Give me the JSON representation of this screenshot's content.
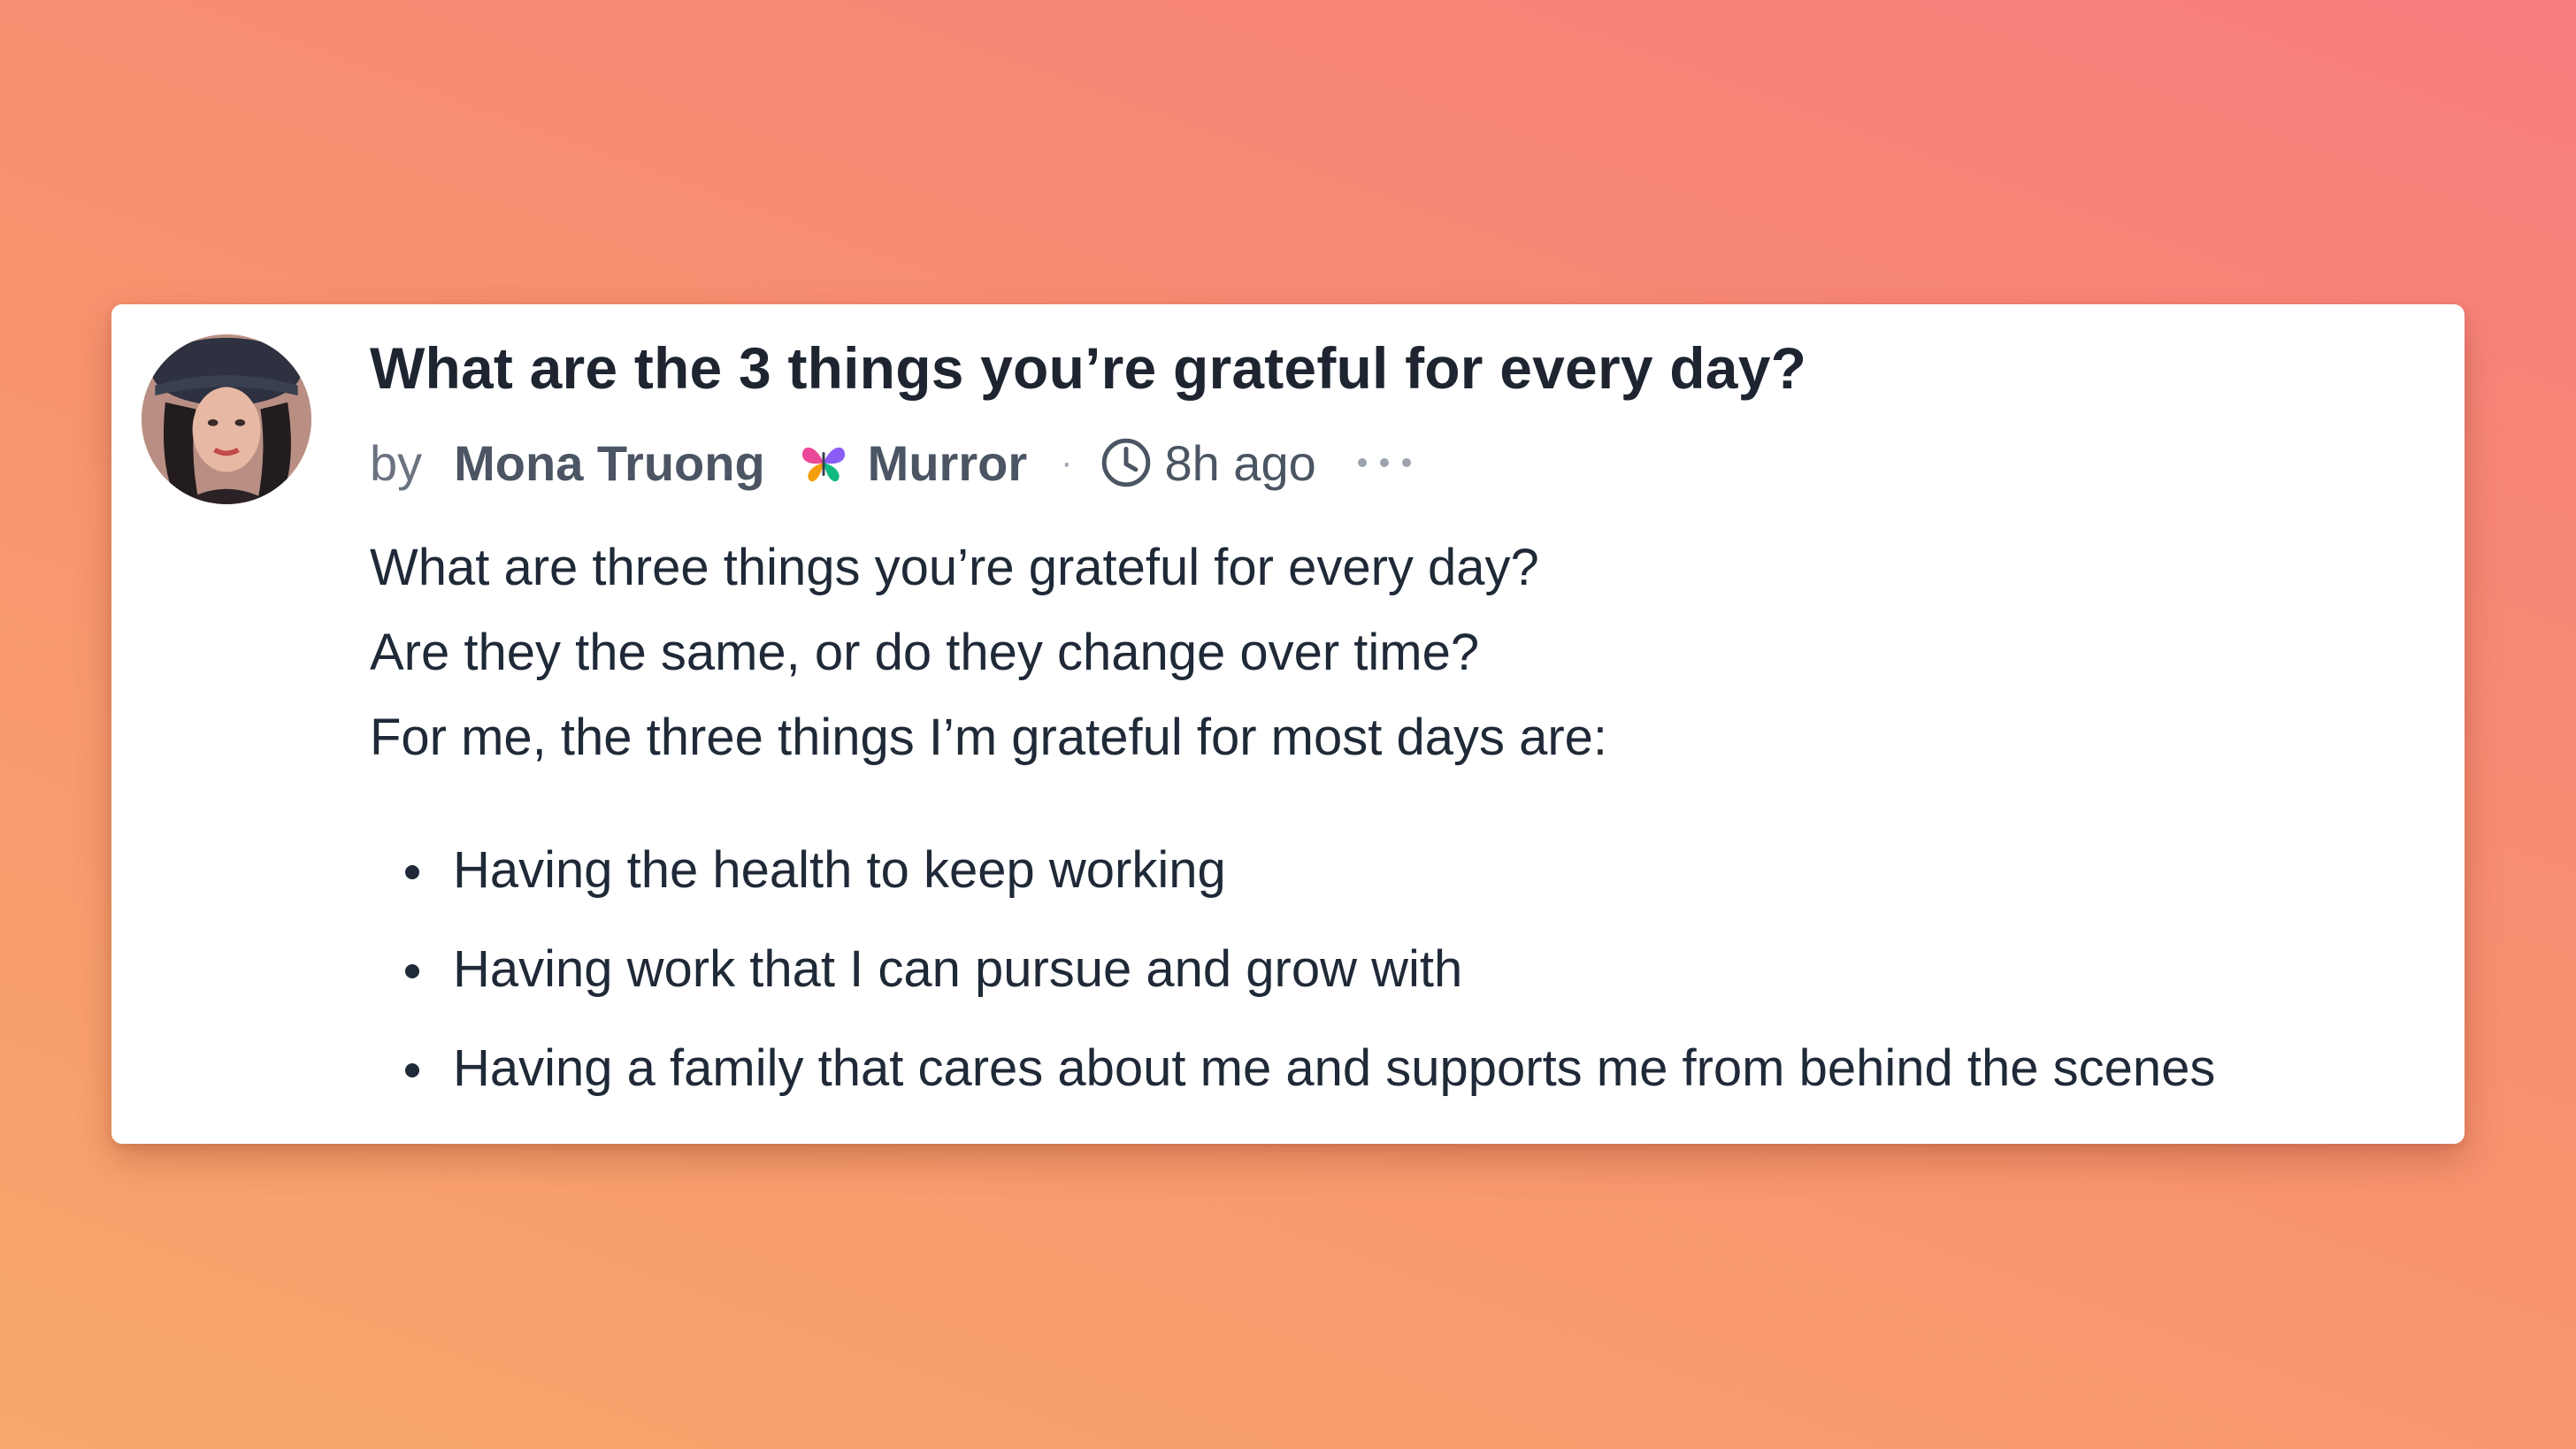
{
  "post": {
    "title": "What are the 3 things you’re grateful for every day?",
    "meta": {
      "by_label": "by",
      "author": "Mona Truong",
      "publication": "Murror",
      "separator": "·",
      "time": "8h ago",
      "icons": {
        "publication": "butterfly-icon",
        "time": "clock-icon",
        "more": "more-horizontal-icon"
      }
    },
    "paragraphs": [
      "What are three things you’re grateful for every day?",
      "Are they the same, or do they change over time?",
      "For me, the three things I’m grateful for most days are:"
    ],
    "list": [
      "Having the health to keep working",
      "Having work that I can pursue and grow with",
      "Having a family that cares about me and supports me from behind the scenes"
    ]
  },
  "colors": {
    "background_start": "#f77e7e",
    "background_end": "#f8a86c",
    "card": "#ffffff",
    "title_text": "#1e2531",
    "meta_text": "#6b7280"
  }
}
